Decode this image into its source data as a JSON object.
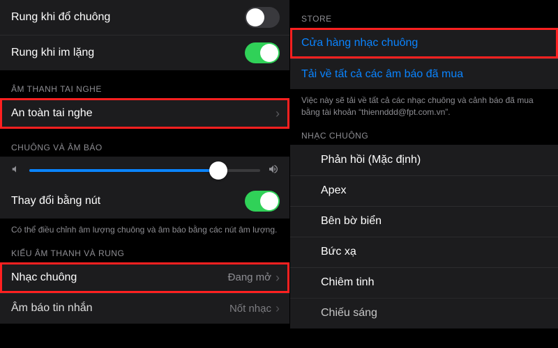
{
  "left": {
    "rows_top": [
      {
        "label": "Rung khi đổ chuông",
        "toggle": false
      },
      {
        "label": "Rung khi im lặng",
        "toggle": true
      }
    ],
    "headphone_header": "ÂM THANH TAI NGHE",
    "headphone_row": {
      "label": "An toàn tai nghe"
    },
    "ringer_header": "CHUÔNG VÀ ÂM BÁO",
    "slider": {
      "percent": 82
    },
    "change_with_buttons": {
      "label": "Thay đổi bằng nút",
      "toggle": true
    },
    "ringer_note": "Có thể điều chỉnh âm lượng chuông và âm báo bằng các nút âm lượng.",
    "pattern_header": "KIỂU ÂM THANH VÀ RUNG",
    "ringtone_row": {
      "label": "Nhạc chuông",
      "value": "Đang mở"
    },
    "sms_row": {
      "label": "Âm báo tin nhắn",
      "value": "Nốt nhạc"
    }
  },
  "right": {
    "store_header": "STORE",
    "store_link": "Cửa hàng nhạc chuông",
    "download_link": "Tải về tất cả các âm báo đã mua",
    "download_note": "Việc này sẽ tải về tất cả các nhạc chuông và cảnh báo đã mua bằng tài khoản “thiennddd@fpt.com.vn”.",
    "ringtone_header": "NHẠC CHUÔNG",
    "ringtones": [
      "Phản hồi (Mặc định)",
      "Apex",
      "Bên bờ biển",
      "Bức xạ",
      "Chiêm tinh",
      "Chiếu sáng"
    ]
  }
}
